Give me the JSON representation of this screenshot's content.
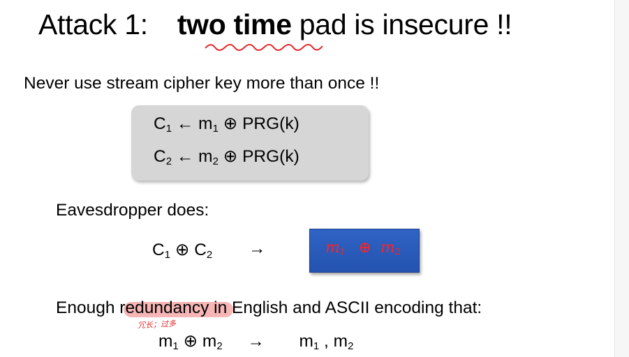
{
  "title": {
    "prefix": "Attack 1:",
    "bold": "two time",
    "suffix": " pad is insecure !!"
  },
  "line1": "Never use stream cipher key more than once !!",
  "box": {
    "eq1": {
      "c": "C",
      "c_sub": "1",
      "arrow": "←",
      "m": "m",
      "m_sub": "1",
      "xor": "⊕",
      "prg": "PRG(k)"
    },
    "eq2": {
      "c": "C",
      "c_sub": "2",
      "arrow": "←",
      "m": "m",
      "m_sub": "2",
      "xor": "⊕",
      "prg": "PRG(k)"
    }
  },
  "eavesdropper": "Eavesdropper does:",
  "cxor": {
    "c1": "C",
    "c1_sub": "1",
    "xor": "⊕",
    "c2": "C",
    "c2_sub": "2",
    "arrow": "→"
  },
  "bluebox": {
    "m1": "m",
    "m1_sub": "1",
    "xor": "⊕",
    "m2": "m",
    "m2_sub": "2"
  },
  "line3": {
    "pre": "Enough ",
    "highlight": "redundancy",
    "post": " in English and ASCII encoding that:"
  },
  "note": "冗长；过多",
  "final": {
    "m1": "m",
    "m1_sub": "1",
    "xor": "⊕",
    "m2": "m",
    "m2_sub": "2",
    "arrow": "→",
    "r1": "m",
    "r1_sub": "1",
    "comma": ",",
    "r2": "m",
    "r2_sub": "2"
  },
  "colors": {
    "blue_box": "#2a5cbd",
    "handwriting_red": "#ff2222",
    "highlight": "#f6b6b6",
    "box_grey": "#d6d6d6"
  }
}
